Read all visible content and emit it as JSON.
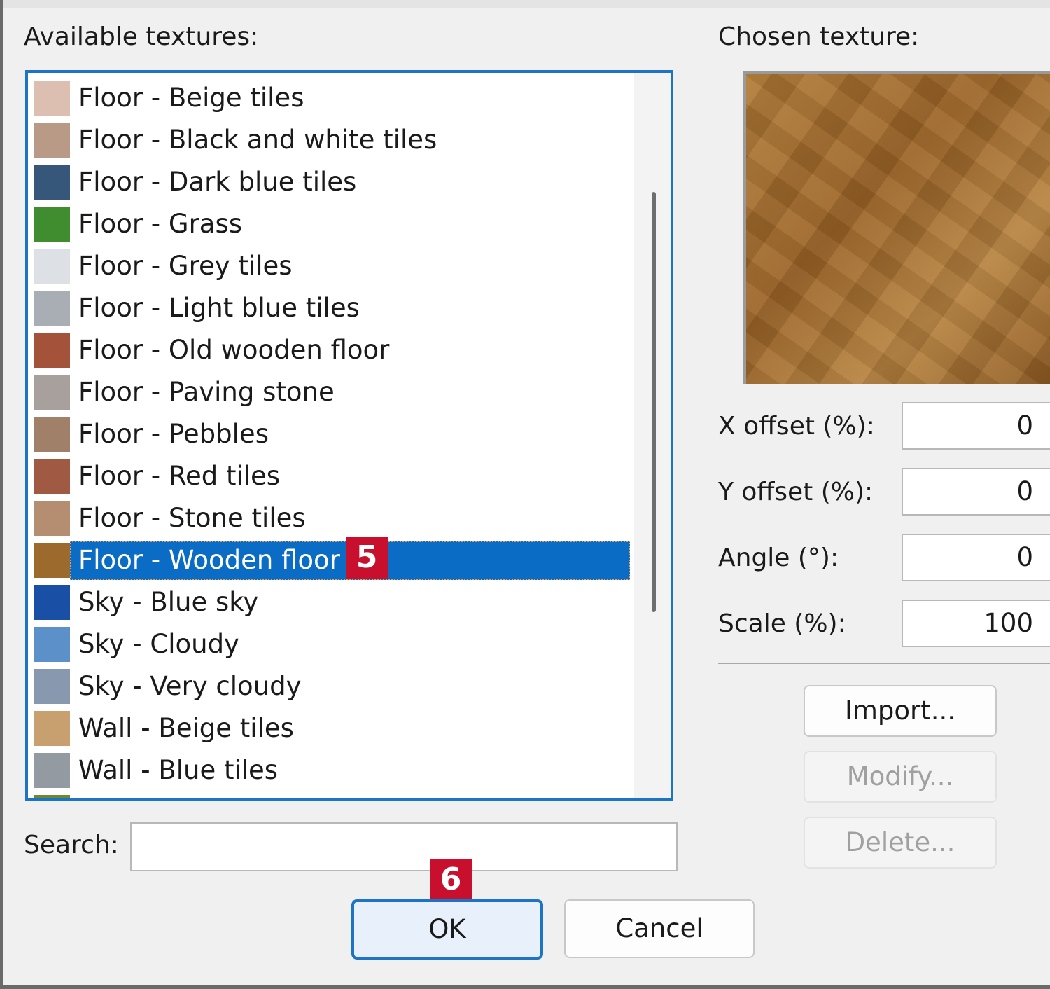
{
  "labels": {
    "available": "Available textures:",
    "chosen": "Chosen texture:",
    "search": "Search:"
  },
  "textures": [
    {
      "label": "Floor - Beige tiles",
      "swatch": "#dcbfb0"
    },
    {
      "label": "Floor - Black and white tiles",
      "swatch": "#b89a86"
    },
    {
      "label": "Floor - Dark blue tiles",
      "swatch": "#37577a"
    },
    {
      "label": "Floor - Grass",
      "swatch": "#3f8d2f"
    },
    {
      "label": "Floor - Grey tiles",
      "swatch": "#dde1e6"
    },
    {
      "label": "Floor - Light blue tiles",
      "swatch": "#a9adb4"
    },
    {
      "label": "Floor - Old wooden floor",
      "swatch": "#a4523a"
    },
    {
      "label": "Floor - Paving stone",
      "swatch": "#a7a09c"
    },
    {
      "label": "Floor - Pebbles",
      "swatch": "#a08068"
    },
    {
      "label": "Floor - Red tiles",
      "swatch": "#a05a44"
    },
    {
      "label": "Floor - Stone tiles",
      "swatch": "#b58e72"
    },
    {
      "label": "Floor - Wooden floor",
      "swatch": "#9c6a2c",
      "selected": true
    },
    {
      "label": "Sky - Blue sky",
      "swatch": "#1a4fa6"
    },
    {
      "label": "Sky - Cloudy",
      "swatch": "#5c90c8"
    },
    {
      "label": "Sky - Very cloudy",
      "swatch": "#8898ae"
    },
    {
      "label": "Wall - Beige tiles",
      "swatch": "#c8a070"
    },
    {
      "label": "Wall - Blue tiles",
      "swatch": "#949aa2"
    },
    {
      "label": "",
      "swatch": "#6e8a30"
    }
  ],
  "fields": {
    "x_offset": {
      "label": "X offset (%):",
      "value": "0"
    },
    "y_offset": {
      "label": "Y offset (%):",
      "value": "0"
    },
    "angle": {
      "label": "Angle (°):",
      "value": "0"
    },
    "scale": {
      "label": "Scale (%):",
      "value": "100"
    }
  },
  "buttons": {
    "import": "Import...",
    "modify": "Modify...",
    "delete": "Delete...",
    "ok": "OK",
    "cancel": "Cancel"
  },
  "search_value": "",
  "badges": {
    "step5": "5",
    "step6": "6"
  },
  "colors": {
    "selection": "#0a6cc4",
    "focus_border": "#1e74c4",
    "badge": "#c8102e"
  }
}
